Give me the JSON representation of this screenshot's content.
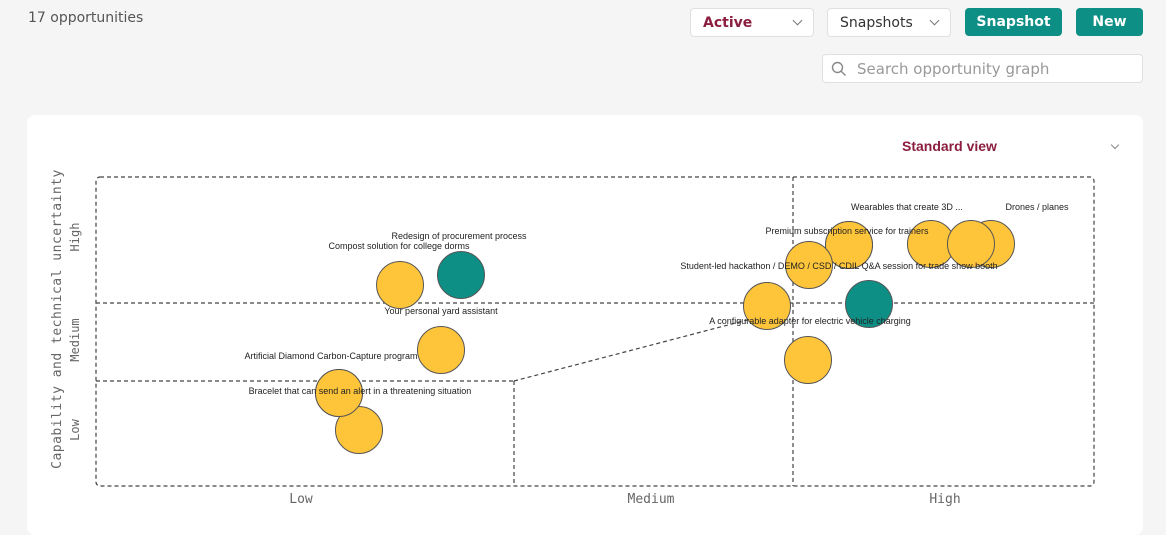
{
  "header": {
    "count_text": "17 opportunities",
    "status_select": "Active",
    "snapshots_select": "Snapshots",
    "snapshot_button": "Snapshot",
    "new_button": "New",
    "search_placeholder": "Search opportunity graph"
  },
  "graph": {
    "view_select": "Standard view",
    "y_axis_title": "Capability and technical uncertainty",
    "y_ticks": [
      "Low",
      "Medium",
      "High"
    ],
    "x_ticks": [
      "Low",
      "Medium",
      "High"
    ],
    "colors": {
      "default": "#fec43a",
      "selected": "#0d8f85",
      "stroke": "#555555"
    },
    "bubbles": [
      {
        "label": "Redesign of procurement process",
        "color": "selected"
      },
      {
        "label": "Compost solution for college dorms",
        "color": "default"
      },
      {
        "label": "Your personal yard assistant",
        "color": "default"
      },
      {
        "label": "Artificial Diamond Carbon-Capture program",
        "color": "default"
      },
      {
        "label": "Bracelet that can send an alert in a threatening situation",
        "color": "default"
      },
      {
        "label": "",
        "color": "default"
      },
      {
        "label": "Wearables that create 3D ...",
        "color": "default"
      },
      {
        "label": "Premium subscription service for trainers",
        "color": "default"
      },
      {
        "label": "Student-led hackathon / DEMO / CSD / CDIL Q&A session for trade show booth",
        "color": "default"
      },
      {
        "label": "",
        "color": "selected"
      },
      {
        "label": "A configurable adapter for electric vehicle charging",
        "color": "default"
      },
      {
        "label": "",
        "color": "default"
      },
      {
        "label": "Drones / planes",
        "color": "default"
      },
      {
        "label": "",
        "color": "default"
      },
      {
        "label": "",
        "color": "default"
      }
    ]
  }
}
